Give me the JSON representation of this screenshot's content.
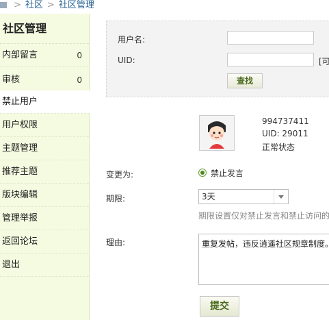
{
  "breadcrumb": {
    "item1": "社区",
    "item2": "社区管理"
  },
  "sidebar": {
    "title": "社区管理",
    "items": [
      {
        "label": "内部留言",
        "count": "0"
      },
      {
        "label": "审核",
        "count": "0"
      },
      {
        "label": "禁止用户",
        "count": ""
      },
      {
        "label": "用户权限",
        "count": ""
      },
      {
        "label": "主题管理",
        "count": ""
      },
      {
        "label": "推荐主题",
        "count": ""
      },
      {
        "label": "版块编辑",
        "count": ""
      },
      {
        "label": "管理举报",
        "count": ""
      },
      {
        "label": "返回论坛",
        "count": ""
      },
      {
        "label": "退出",
        "count": ""
      }
    ],
    "active_item": "禁止用户"
  },
  "search": {
    "username_label": "用户名:",
    "username_value": "",
    "uid_label": "UID:",
    "uid_value": "",
    "uid_trailing": "[可",
    "find_button": "查找"
  },
  "user": {
    "name": "994737411",
    "uid": "UID: 29011",
    "status": "正常状态"
  },
  "form": {
    "change_to_label": "变更为:",
    "change_to_option": "禁止发言",
    "period_label": "期限:",
    "period_value": "3天",
    "period_hint": "期限设置仅对禁止发言和禁止访问的",
    "reason_label": "理由:",
    "reason_value": "重复发帖，违反逍遥社区规章制度。",
    "submit_button": "提交"
  },
  "colors": {
    "sidebar_bg": "#f5fbe0",
    "link": "#2a6496",
    "button_text": "#4a6a1e"
  }
}
